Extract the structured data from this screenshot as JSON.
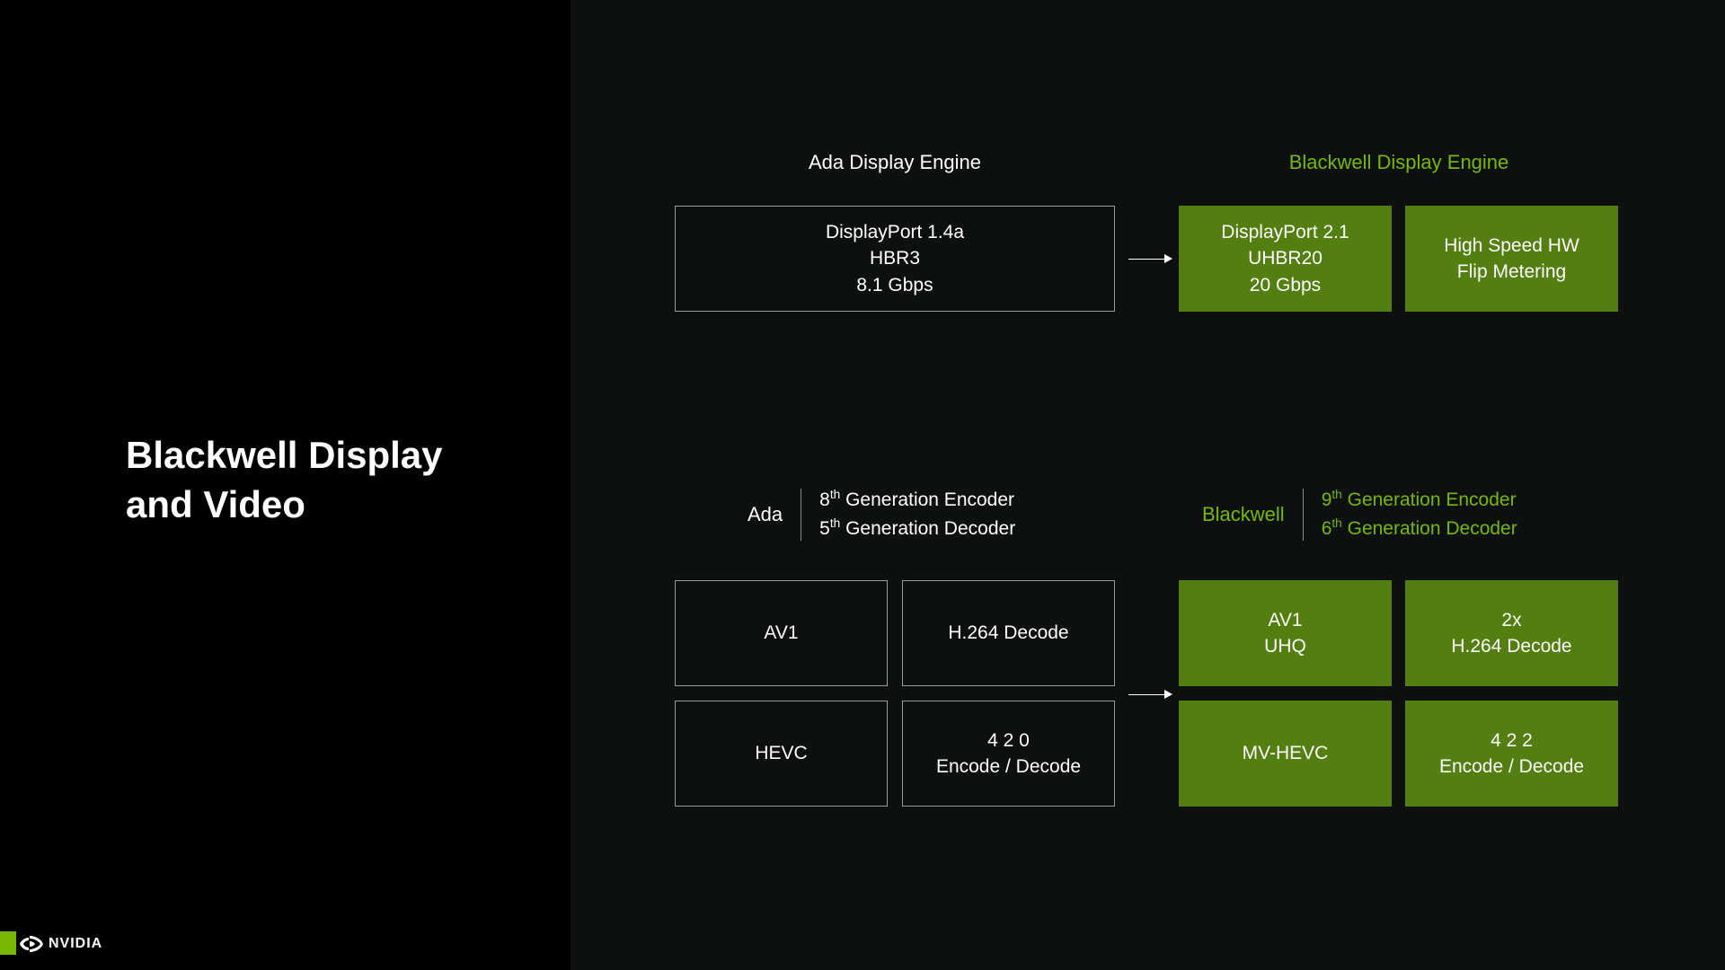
{
  "title_line1": "Blackwell Display",
  "title_line2": "and Video",
  "top_section": {
    "ada_heading": "Ada Display Engine",
    "blackwell_heading": "Blackwell Display Engine",
    "ada_box": {
      "line1": "DisplayPort 1.4a",
      "line2": "HBR3",
      "line3": "8.1 Gbps"
    },
    "blackwell_box1": {
      "line1": "DisplayPort 2.1",
      "line2": "UHBR20",
      "line3": "20 Gbps"
    },
    "blackwell_box2": {
      "line1": "High Speed HW",
      "line2": "Flip Metering"
    }
  },
  "bottom_section": {
    "ada_label": "Ada",
    "ada_enc_gen": "8",
    "ada_enc_suffix": " Generation Encoder",
    "ada_dec_gen": "5",
    "ada_dec_suffix": " Generation Decoder",
    "blackwell_label": "Blackwell",
    "bw_enc_gen": "9",
    "bw_enc_suffix": " Generation Encoder",
    "bw_dec_gen": "6",
    "bw_dec_suffix": " Generation Decoder",
    "ada_codecs": {
      "c1": "AV1",
      "c2": "H.264 Decode",
      "c3": "HEVC",
      "c4_line1": "4 2 0",
      "c4_line2": "Encode / Decode"
    },
    "bw_codecs": {
      "c1_line1": "AV1",
      "c1_line2": "UHQ",
      "c2_line1": "2x",
      "c2_line2": "H.264 Decode",
      "c3": "MV-HEVC",
      "c4_line1": "4 2 2",
      "c4_line2": "Encode / Decode"
    }
  },
  "logo_text": "NVIDIA",
  "th_suffix": "th"
}
